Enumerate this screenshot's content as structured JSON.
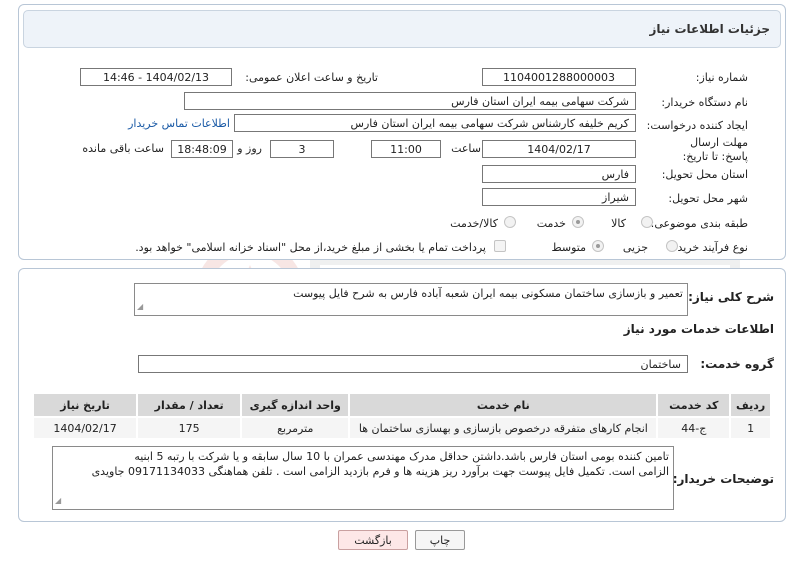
{
  "panel_title": "جزئیات اطلاعات نیاز",
  "fields": {
    "need_number_label": "شماره نیاز:",
    "need_number": "1104001288000003",
    "announce_label": "تاریخ و ساعت اعلان عمومی:",
    "announce_value": "1404/02/13 - 14:46",
    "buyer_label": "نام دستگاه خریدار:",
    "buyer_value": "شرکت سهامی بیمه ایران استان فارس",
    "creator_label": "ایجاد کننده درخواست:",
    "creator_value": "کریم خلیفه کارشناس شرکت سهامی بیمه ایران استان فارس",
    "contact_link": "اطلاعات تماس خریدار",
    "deadline_label": "مهلت ارسال پاسخ: تا تاریخ:",
    "deadline_date": "1404/02/17",
    "time_label": "ساعت",
    "deadline_time": "11:00",
    "days_value": "3",
    "days_label": "روز و",
    "remaining_time": "18:48:09",
    "remaining_label": "ساعت باقی مانده",
    "province_label": "استان محل تحویل:",
    "province_value": "فارس",
    "city_label": "شهر محل تحویل:",
    "city_value": "شیراز",
    "category_label": "طبقه بندی موضوعی:",
    "category_options": [
      "کالا",
      "خدمت",
      "کالا/خدمت"
    ],
    "category_selected": "خدمت",
    "process_label": "نوع فرآیند خرید :",
    "process_options": [
      "جزیی",
      "متوسط"
    ],
    "process_selected": "متوسط",
    "payment_note": "پرداخت تمام یا بخشی از مبلغ خرید،از محل \"اسناد خزانه اسلامی\" خواهد بود."
  },
  "summary": {
    "label": "شرح کلی نیاز:",
    "value": "تعمیر و بازسازی ساختمان مسکونی بیمه ایران شعبه آباده فارس به شرح فایل پیوست"
  },
  "services": {
    "section_title": "اطلاعات خدمات مورد نیاز",
    "group_label": "گروه خدمت:",
    "group_value": "ساختمان",
    "headers": [
      "ردیف",
      "کد خدمت",
      "نام خدمت",
      "واحد اندازه گیری",
      "تعداد / مقدار",
      "تاریخ نیاز"
    ],
    "rows": [
      [
        "1",
        "ج-44",
        "انجام کارهای متفرقه درخصوص بازسازی و بهسازی ساختمان ها",
        "مترمربع",
        "175",
        "1404/02/17"
      ]
    ]
  },
  "buyer_notes": {
    "label": "توضیحات خریدار:",
    "line1": "تامین کننده بومی استان فارس باشد.داشتن حداقل مدرک مهندسی عمران با 10 سال سابقه و یا شرکت با رتبه 5 ابنیه",
    "line2": "الزامی است. تکمیل فایل پیوست جهت برآورد ریز هزینه ها و فرم بازدید الزامی است . تلفن هماهنگی 09171134033 جاویدی"
  },
  "buttons": {
    "print": "چاپ",
    "back": "بازگشت"
  },
  "colors": {
    "link": "#1a5aa6",
    "header_bg": "#eef3f9",
    "back_button_bg": "#fde7e7"
  }
}
